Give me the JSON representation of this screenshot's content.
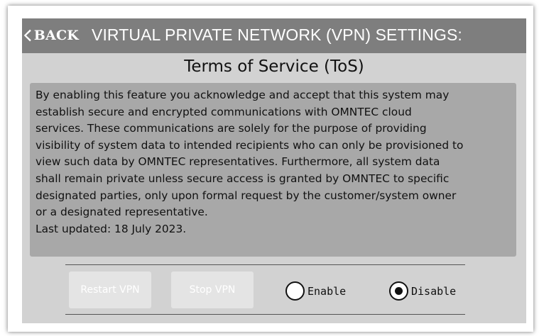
{
  "header": {
    "back_label": "BACK",
    "title": "VIRTUAL PRIVATE NETWORK (VPN) SETTINGS:"
  },
  "tos": {
    "title": "Terms of Service (ToS)",
    "body": "By enabling this feature you acknowledge and accept that this system may\nestablish secure and encrypted communications with OMNTEC cloud\nservices. These communications are solely for the purpose of providing\nvisibility of system data to intended recipients who can only be provisioned to\n view such data by OMNTEC representatives. Furthermore, all system data\nshall remain private unless secure access is granted by OMNTEC to specific\ndesignated parties, only upon formal request by the customer/system owner\nor a designated representative.\nLast updated: 18 July 2023."
  },
  "controls": {
    "restart_label": "Restart VPN",
    "stop_label": "Stop VPN",
    "enable_label": "Enable",
    "disable_label": "Disable",
    "selected": "Disable"
  },
  "icons": {
    "back": "chevron-left-icon"
  },
  "colors": {
    "header_bg": "#7e7e7e",
    "screen_bg": "#d2d2d2",
    "tos_box_bg": "#a8a8a8",
    "disabled_button_bg": "#e4e4e4"
  }
}
